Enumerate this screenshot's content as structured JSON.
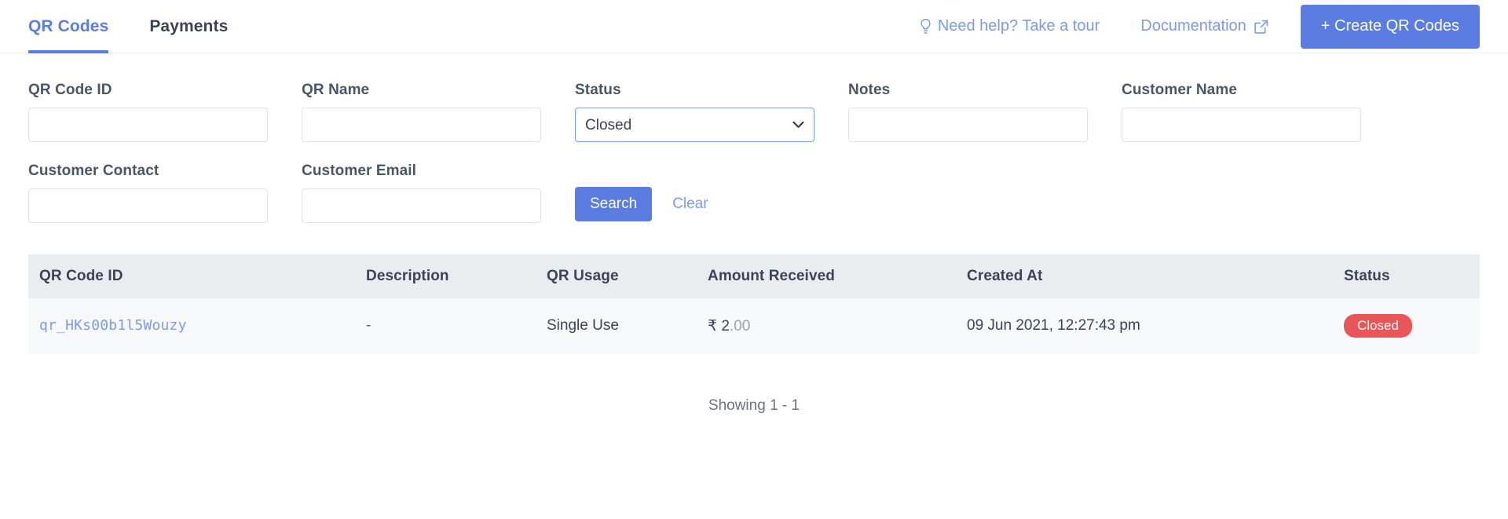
{
  "nav": {
    "tabs": [
      {
        "label": "QR Codes",
        "active": true
      },
      {
        "label": "Payments",
        "active": false
      }
    ],
    "help_link": "Need help? Take a tour",
    "help_icon": "lightbulb-icon",
    "documentation_link": "Documentation",
    "documentation_icon": "external-link-icon",
    "create_button": "+ Create QR Codes",
    "accent_color": "#5b7ce0",
    "link_color": "#7d9ae8"
  },
  "filters": {
    "row1": [
      {
        "label": "QR Code ID",
        "value": "",
        "placeholder": "",
        "type": "text"
      },
      {
        "label": "QR Name",
        "value": "",
        "placeholder": "",
        "type": "text"
      },
      {
        "label": "Status",
        "value": "Closed",
        "type": "select",
        "options": [
          "Closed"
        ]
      },
      {
        "label": "Notes",
        "value": "",
        "placeholder": "",
        "type": "text"
      },
      {
        "label": "Customer Name",
        "value": "",
        "placeholder": "",
        "type": "text"
      }
    ],
    "row2": [
      {
        "label": "Customer Contact",
        "value": "",
        "placeholder": "",
        "type": "text"
      },
      {
        "label": "Customer Email",
        "value": "",
        "placeholder": "",
        "type": "text"
      }
    ],
    "search_button": "Search",
    "clear_button": "Clear",
    "select_icon": "chevron-down-icon"
  },
  "table": {
    "columns": [
      "QR Code ID",
      "Description",
      "QR Usage",
      "Amount Received",
      "Created At",
      "Status"
    ],
    "rows": [
      {
        "qr_code_id": "qr_HKs00b1l5Wouzy",
        "description": "-",
        "qr_usage": "Single Use",
        "amount_symbol": "₹",
        "amount_whole": "2",
        "amount_cents": ".00",
        "created_at": "09 Jun 2021, 12:27:43 pm",
        "status": "Closed",
        "status_color": "#e8565a"
      }
    ]
  },
  "footer": {
    "showing": "Showing 1 - 1"
  }
}
